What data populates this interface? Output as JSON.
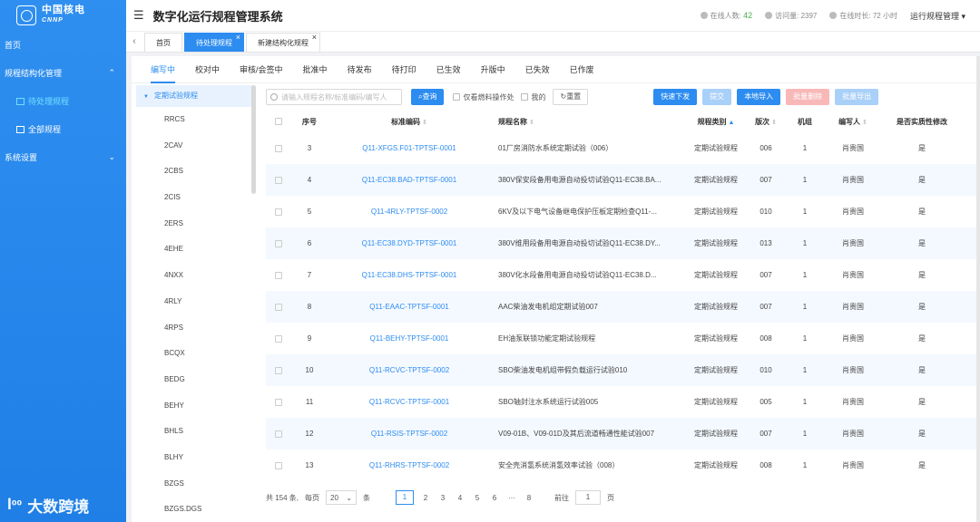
{
  "brand": {
    "cn": "中国核电",
    "en": "CNNP"
  },
  "sidebar": {
    "items": [
      {
        "label": "首页",
        "type": "top"
      },
      {
        "label": "规程结构化管理",
        "type": "group",
        "arrow": "^"
      },
      {
        "label": "待处理规程",
        "type": "sub",
        "active": true
      },
      {
        "label": "全部规程",
        "type": "sub"
      },
      {
        "label": "系统设置",
        "type": "group",
        "arrow": "v"
      }
    ]
  },
  "watermark": "大数跨境",
  "header": {
    "title": "数字化运行规程管理系统",
    "online_label": "在线人数:",
    "online_value": "42",
    "visits_label": "访问量:",
    "visits_value": "2397",
    "duration_label": "在线时长:",
    "duration_value": "72 小时",
    "role": "运行规程管理"
  },
  "page_tabs": [
    {
      "label": "首页",
      "closable": false
    },
    {
      "label": "待处理规程",
      "closable": true,
      "active": true
    },
    {
      "label": "新建结构化规程",
      "closable": true
    }
  ],
  "status_tabs": [
    "编写中",
    "校对中",
    "审核/会签中",
    "批准中",
    "待发布",
    "待打印",
    "已生效",
    "升版中",
    "已失效",
    "已作废"
  ],
  "tree": {
    "root": "定期试验规程",
    "items": [
      "RRCS",
      "2CAV",
      "2CBS",
      "2CIS",
      "2ERS",
      "4EHE",
      "4NXX",
      "4RLY",
      "4RPS",
      "BCQX",
      "BEDG",
      "BEHY",
      "BHLS",
      "BLHY",
      "BZGS",
      "BZGS.DGS"
    ]
  },
  "toolbar": {
    "search_placeholder": "请输入规程名称/标准编码/编写人",
    "query": "查询",
    "only_fuel": "仅看燃料操作处",
    "mine": "我的",
    "reset": "重置",
    "quick_issue": "快速下发",
    "submit": "提交",
    "local_import": "本地导入",
    "batch_delete": "批量删除",
    "batch_export": "批量导出"
  },
  "table": {
    "headers": {
      "no": "序号",
      "code": "标准编码",
      "name": "规程名称",
      "type": "规程类别",
      "version": "版次",
      "unit": "机组",
      "author": "编写人",
      "substantive": "是否实质性修改"
    },
    "rows": [
      {
        "no": "3",
        "code": "Q11-XFGS.F01-TPTSF-0001",
        "name": "01厂房消防水系统定期试验（006）",
        "type": "定期试验规程",
        "version": "006",
        "unit": "1",
        "author": "肖贵国",
        "substantive": "是"
      },
      {
        "no": "4",
        "code": "Q11-EC38.BAD-TPTSF-0001",
        "name": "380V保安段备用电源自动投切试验Q11-EC38.BA...",
        "type": "定期试验规程",
        "version": "007",
        "unit": "1",
        "author": "肖贵国",
        "substantive": "是"
      },
      {
        "no": "5",
        "code": "Q11-4RLY-TPTSF-0002",
        "name": "6KV及以下电气设备继电保护压板定期检查Q11-...",
        "type": "定期试验规程",
        "version": "010",
        "unit": "1",
        "author": "肖贵国",
        "substantive": "是"
      },
      {
        "no": "6",
        "code": "Q11-EC38.DYD-TPTSF-0001",
        "name": "380V维用段备用电源自动投切试验Q11-EC38.DY...",
        "type": "定期试验规程",
        "version": "013",
        "unit": "1",
        "author": "肖贵国",
        "substantive": "是"
      },
      {
        "no": "7",
        "code": "Q11-EC38.DHS-TPTSF-0001",
        "name": "380V化水段备用电源自动投切试验Q11-EC38.D...",
        "type": "定期试验规程",
        "version": "007",
        "unit": "1",
        "author": "肖贵国",
        "substantive": "是"
      },
      {
        "no": "8",
        "code": "Q11-EAAC-TPTSF-0001",
        "name": "AAC柴油发电机组定期试验007",
        "type": "定期试验规程",
        "version": "007",
        "unit": "1",
        "author": "肖贵国",
        "substantive": "是"
      },
      {
        "no": "9",
        "code": "Q11-BEHY-TPTSF-0001",
        "name": "EH油泵联锁功能定期试验规程",
        "type": "定期试验规程",
        "version": "008",
        "unit": "1",
        "author": "肖贵国",
        "substantive": "是"
      },
      {
        "no": "10",
        "code": "Q11-RCVC-TPTSF-0002",
        "name": "SBO柴油发电机组带假负载运行试验010",
        "type": "定期试验规程",
        "version": "010",
        "unit": "1",
        "author": "肖贵国",
        "substantive": "是"
      },
      {
        "no": "11",
        "code": "Q11-RCVC-TPTSF-0001",
        "name": "SBO轴封注水系统运行试验005",
        "type": "定期试验规程",
        "version": "005",
        "unit": "1",
        "author": "肖贵国",
        "substantive": "是"
      },
      {
        "no": "12",
        "code": "Q11-RSIS-TPTSF-0002",
        "name": "V09-01B、V09-01D及其后流道畅通性能试验007",
        "type": "定期试验规程",
        "version": "007",
        "unit": "1",
        "author": "肖贵国",
        "substantive": "是"
      },
      {
        "no": "13",
        "code": "Q11-RHRS-TPTSF-0002",
        "name": "安全壳消氢系统消氢效率试验（008）",
        "type": "定期试验规程",
        "version": "008",
        "unit": "1",
        "author": "肖贵国",
        "substantive": "是"
      }
    ]
  },
  "pager": {
    "total": "共 154 条,",
    "per_page_label": "每页",
    "per_page": "20",
    "unit": "条",
    "pages": [
      "1",
      "2",
      "3",
      "4",
      "5",
      "6",
      "···",
      "8"
    ],
    "goto_label": "前往",
    "goto_value": "1",
    "goto_unit": "页"
  }
}
